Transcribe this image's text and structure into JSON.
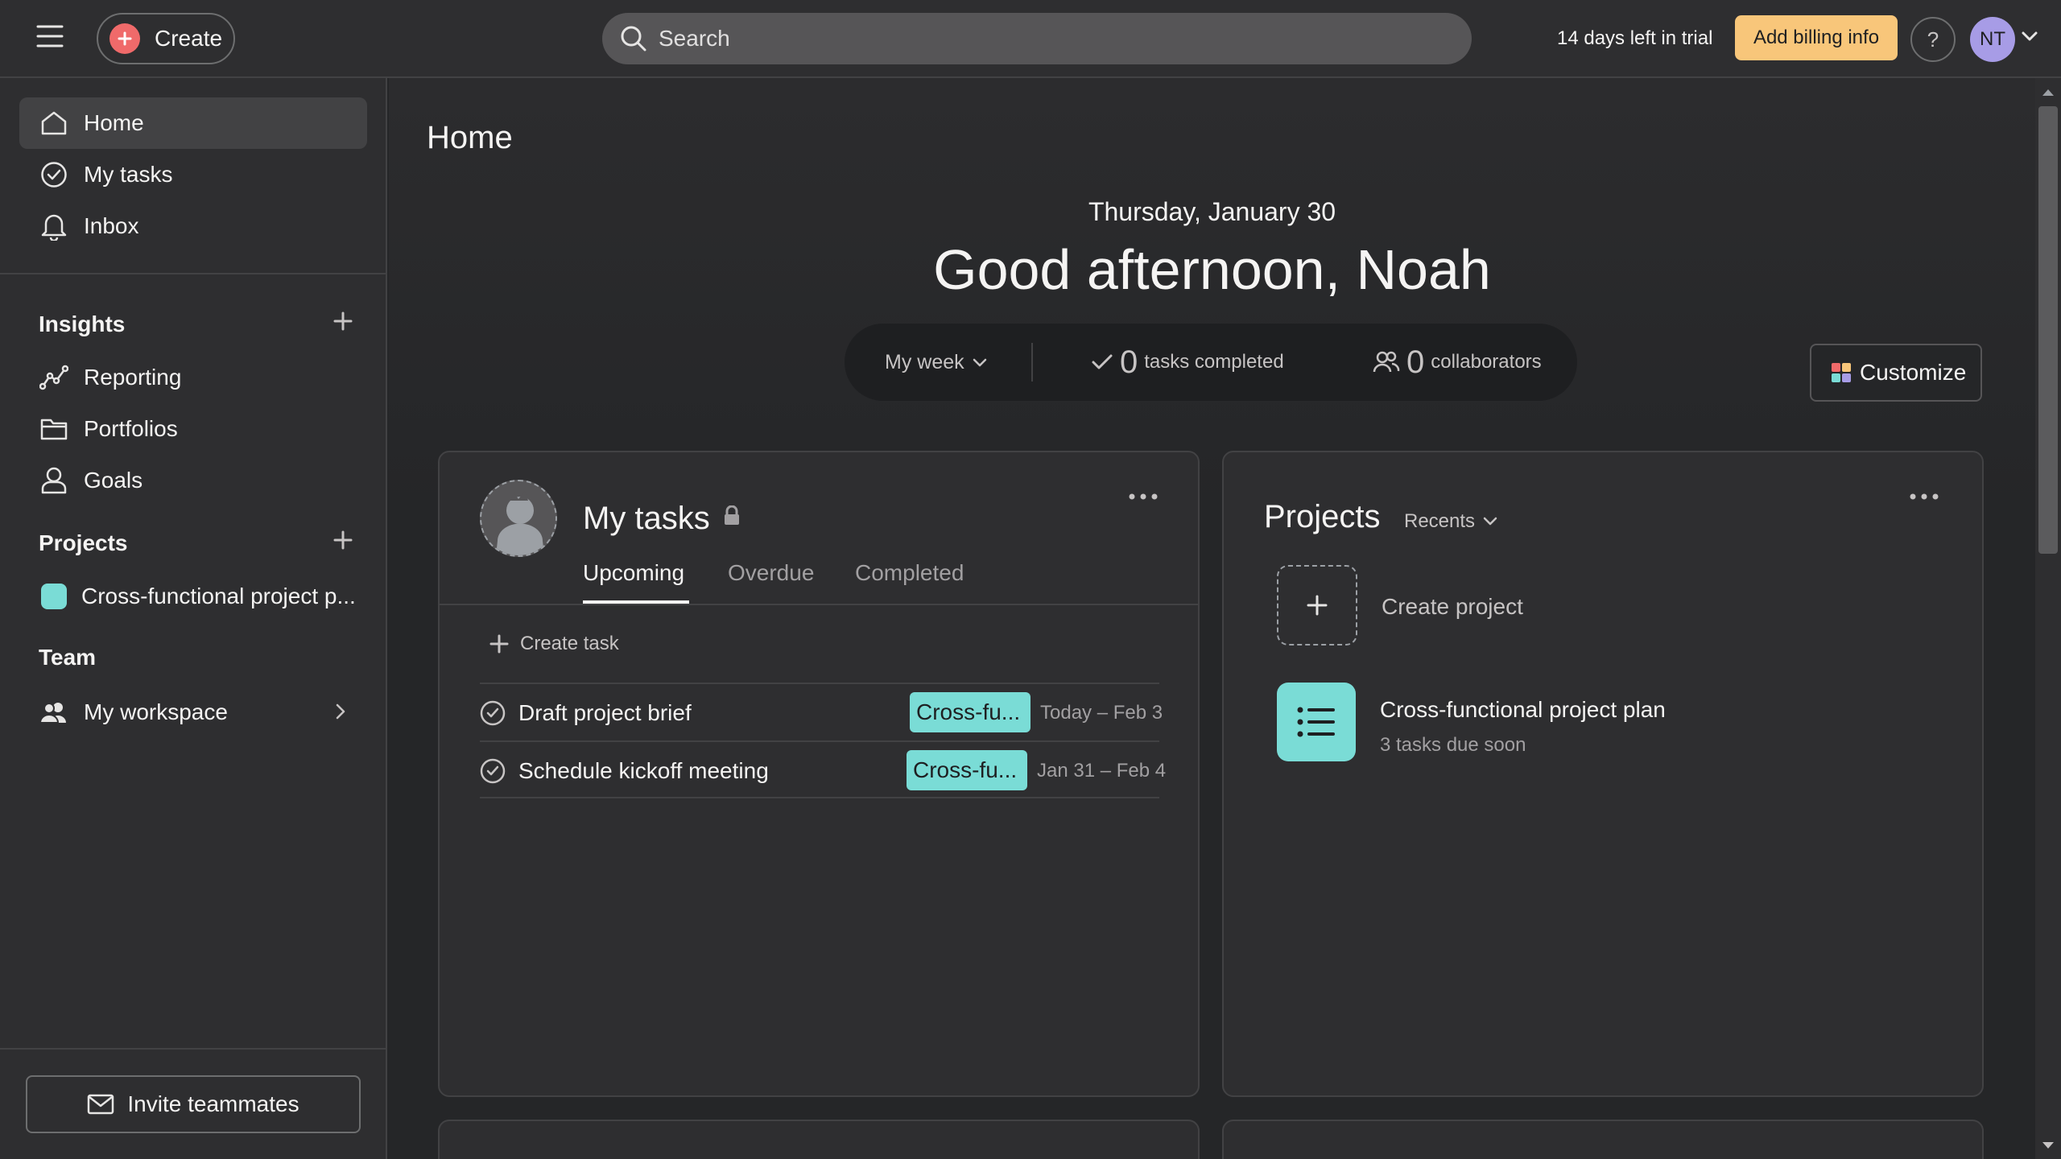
{
  "topbar": {
    "create_label": "Create",
    "search_placeholder": "Search",
    "trial_text": "14 days left in trial",
    "billing_label": "Add billing info",
    "help_label": "?",
    "avatar_initials": "NT"
  },
  "sidebar": {
    "nav": [
      {
        "label": "Home",
        "icon": "home-icon"
      },
      {
        "label": "My tasks",
        "icon": "check-circle-icon"
      },
      {
        "label": "Inbox",
        "icon": "bell-icon"
      }
    ],
    "insights_heading": "Insights",
    "insights": [
      {
        "label": "Reporting",
        "icon": "line-chart-icon"
      },
      {
        "label": "Portfolios",
        "icon": "folder-icon"
      },
      {
        "label": "Goals",
        "icon": "person-icon"
      }
    ],
    "projects_heading": "Projects",
    "projects": [
      {
        "label": "Cross-functional project p...",
        "color": "#7adcd6"
      }
    ],
    "team_heading": "Team",
    "team": [
      {
        "label": "My workspace",
        "icon": "people-icon"
      }
    ],
    "invite_label": "Invite teammates"
  },
  "main": {
    "page_title": "Home",
    "date": "Thursday, January 30",
    "greeting": "Good afternoon, Noah",
    "stats": {
      "period": "My week",
      "tasks_completed_count": "0",
      "tasks_completed_label": "tasks completed",
      "collaborators_count": "0",
      "collaborators_label": "collaborators"
    },
    "customize_label": "Customize",
    "my_tasks": {
      "title": "My tasks",
      "tabs": [
        "Upcoming",
        "Overdue",
        "Completed"
      ],
      "active_tab": "Upcoming",
      "create_task_label": "Create task",
      "tasks": [
        {
          "name": "Draft project brief",
          "project_tag": "Cross-fu...",
          "date": "Today – Feb 3"
        },
        {
          "name": "Schedule kickoff meeting",
          "project_tag": "Cross-fu...",
          "date": "Jan 31 – Feb 4"
        }
      ]
    },
    "projects_card": {
      "title": "Projects",
      "filter": "Recents",
      "create_label": "Create project",
      "items": [
        {
          "name": "Cross-functional project plan",
          "subtitle": "3 tasks due soon",
          "color": "#7adcd6"
        }
      ]
    }
  },
  "colors": {
    "accent_create": "#f06a6a",
    "billing": "#f8c67a",
    "avatar": "#a79ce6",
    "project": "#7adcd6"
  }
}
